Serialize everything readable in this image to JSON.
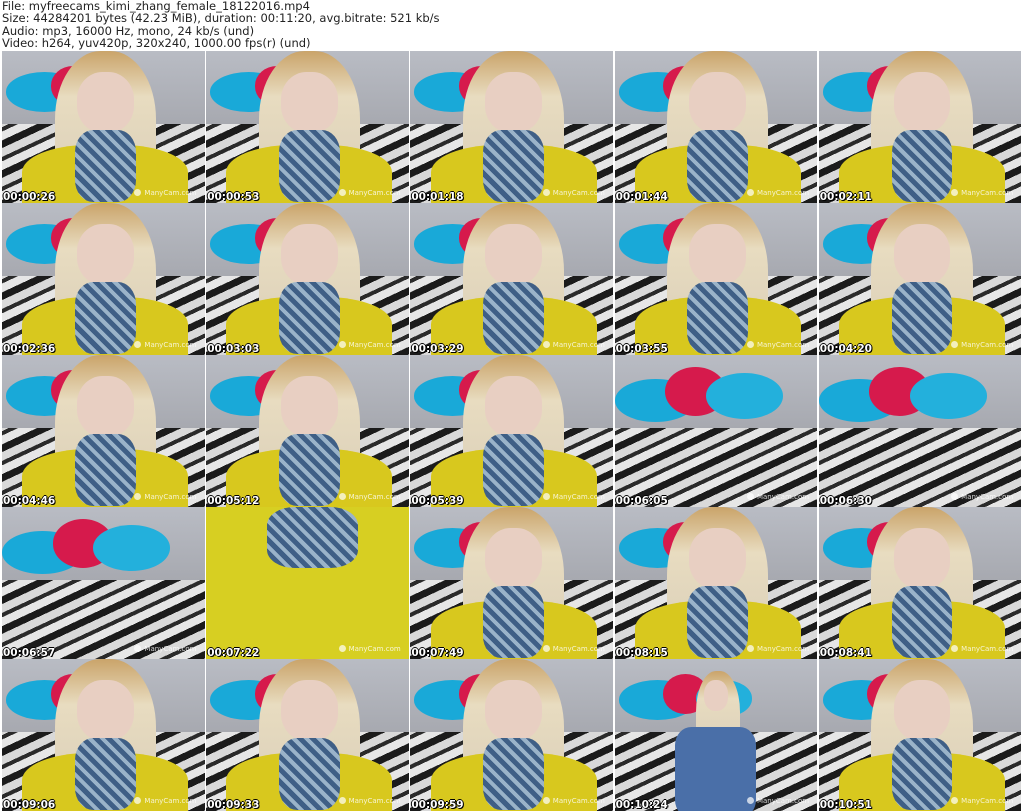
{
  "header": {
    "file": "File: myfreecams_kimi_zhang_female_18122016.mp4",
    "size": "Size: 44284201 bytes (42.23 MiB), duration: 00:11:20, avg.bitrate: 521 kb/s",
    "audio": "Audio: mp3, 16000 Hz, mono, 24 kb/s (und)",
    "video": "Video: h264, yuv420p, 320x240, 1000.00 fps(r) (und)"
  },
  "watermark": "ManyCam.com",
  "thumbnails": [
    {
      "timestamp": "00:00:26"
    },
    {
      "timestamp": "00:00:53"
    },
    {
      "timestamp": "00:01:18"
    },
    {
      "timestamp": "00:01:44"
    },
    {
      "timestamp": "00:02:11"
    },
    {
      "timestamp": "00:02:36"
    },
    {
      "timestamp": "00:03:03"
    },
    {
      "timestamp": "00:03:29"
    },
    {
      "timestamp": "00:03:55"
    },
    {
      "timestamp": "00:04:20"
    },
    {
      "timestamp": "00:04:46"
    },
    {
      "timestamp": "00:05:12"
    },
    {
      "timestamp": "00:05:39"
    },
    {
      "timestamp": "00:06:05"
    },
    {
      "timestamp": "00:06:30"
    },
    {
      "timestamp": "00:06:57"
    },
    {
      "timestamp": "00:07:22"
    },
    {
      "timestamp": "00:07:49"
    },
    {
      "timestamp": "00:08:15"
    },
    {
      "timestamp": "00:08:41"
    },
    {
      "timestamp": "00:09:06"
    },
    {
      "timestamp": "00:09:33"
    },
    {
      "timestamp": "00:09:59"
    },
    {
      "timestamp": "00:10:24"
    },
    {
      "timestamp": "00:10:51"
    }
  ]
}
